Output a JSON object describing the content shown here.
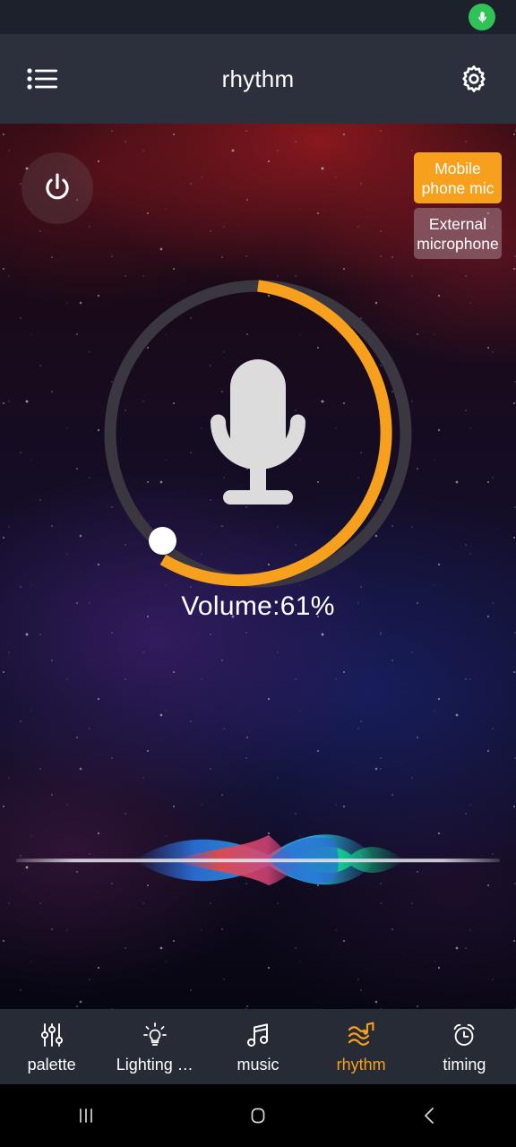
{
  "status_bar": {
    "mic_indicator_icon": "microphone-icon",
    "mic_indicator_color": "#31c257"
  },
  "header": {
    "menu_icon": "list-menu-icon",
    "title": "rhythm",
    "settings_icon": "gear-icon"
  },
  "main": {
    "power_button": {
      "icon": "power-icon",
      "state": "off"
    },
    "mic_sources": [
      {
        "label": "Mobile phone mic",
        "selected": true
      },
      {
        "label": "External microphone",
        "selected": false
      }
    ],
    "volume_dial": {
      "center_icon": "microphone-icon",
      "value_percent": 61,
      "arc_start_deg": 0,
      "arc_sweep_deg": 220,
      "track_color": "#3a3740",
      "progress_color": "#f7a01e",
      "knob_color": "#ffffff"
    },
    "volume_label": "Volume:61%",
    "waveform": {
      "type": "audio-visualizer",
      "baseline_color": "#e8e8ee",
      "blob_colors": [
        "#2a6fd6",
        "#d8455a",
        "#18c98c",
        "#2bb6e0"
      ]
    }
  },
  "tabbar": {
    "items": [
      {
        "label": "palette",
        "icon": "sliders-icon",
        "active": false
      },
      {
        "label": "Lighting …",
        "icon": "lightbulb-icon",
        "active": false
      },
      {
        "label": "music",
        "icon": "music-note-icon",
        "active": false
      },
      {
        "label": "rhythm",
        "icon": "rhythm-wave-icon",
        "active": true
      },
      {
        "label": "timing",
        "icon": "alarm-clock-icon",
        "active": false
      }
    ],
    "active_color": "#f7a01e",
    "inactive_color": "#ffffff"
  },
  "system_nav": {
    "recents_icon": "recents-icon",
    "home_icon": "home-icon",
    "back_icon": "back-icon"
  }
}
